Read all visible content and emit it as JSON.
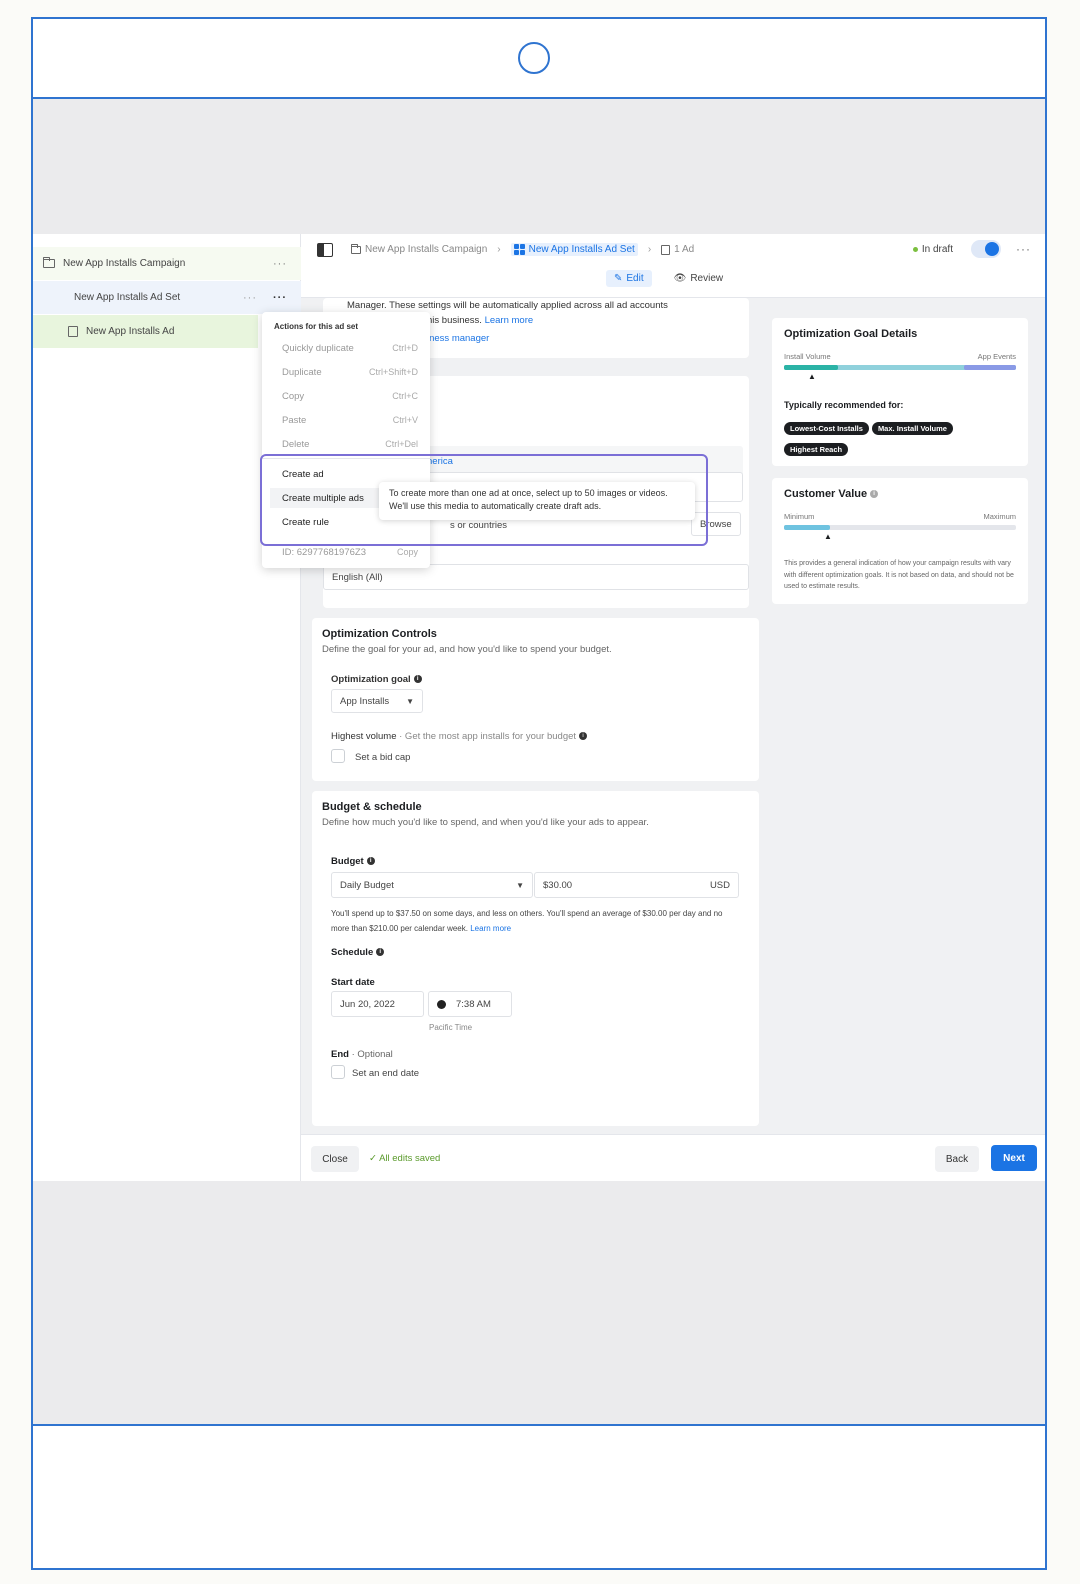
{
  "tree": {
    "campaign": "New App Installs Campaign",
    "adset": "New App Installs Ad Set",
    "ad": "New App Installs Ad",
    "more": "···"
  },
  "topbar": {
    "crumb_campaign": "New App Installs Campaign",
    "crumb_adset": "New App Installs Ad Set",
    "crumb_ad": "1 Ad",
    "status": "In draft",
    "more": "···",
    "tab_edit": "Edit",
    "tab_review": "Review"
  },
  "card_a": {
    "line1": "Manager. These settings will be automatically applied across all ad accounts",
    "line2": "his business.",
    "learn_more": "Learn more",
    "link2": "iness manager"
  },
  "card_b": {
    "location_link": "nerica",
    "countries_text": "s or countries",
    "browse": "Browse",
    "language_value": "English (All)"
  },
  "menu": {
    "title": "Actions for this ad set",
    "items": [
      {
        "label": "Quickly duplicate",
        "shortcut": "Ctrl+D"
      },
      {
        "label": "Duplicate",
        "shortcut": "Ctrl+Shift+D"
      },
      {
        "label": "Copy",
        "shortcut": "Ctrl+C"
      },
      {
        "label": "Paste",
        "shortcut": "Ctrl+V"
      },
      {
        "label": "Delete",
        "shortcut": "Ctrl+Del"
      }
    ],
    "create_ad": "Create ad",
    "create_multiple": "Create multiple ads",
    "create_rule": "Create rule",
    "id": "ID: 62977681976Z3",
    "copy": "Copy",
    "tooltip": "To create more than one ad at once, select up to 50 images or videos. We'll use this media to automatically create draft ads."
  },
  "optimization": {
    "title": "Optimization Controls",
    "subtitle": "Define the goal for your ad, and how you'd like to spend your budget.",
    "goal_label": "Optimization goal",
    "goal_value": "App Installs",
    "strategy_bold": "Highest volume",
    "strategy_rest": " · Get the most app installs for your budget",
    "bid_cap": "Set a bid cap"
  },
  "budget": {
    "title": "Budget & schedule",
    "subtitle": "Define how much you'd like to spend, and when you'd like your ads to appear.",
    "budget_label": "Budget",
    "type": "Daily Budget",
    "amount": "$30.00",
    "currency": "USD",
    "note": "You'll spend up to $37.50 on some days, and less on others. You'll spend an average of $30.00 per day and no more than $210.00 per calendar week.",
    "learn_more": "Learn more",
    "schedule_label": "Schedule",
    "start_label": "Start date",
    "start_date": "Jun 20, 2022",
    "start_time": "7:38 AM",
    "timezone": "Pacific Time",
    "end_label": "End",
    "end_optional": " · Optional",
    "end_checkbox": "Set an end date"
  },
  "goal_details": {
    "title": "Optimization Goal Details",
    "left": "Install Volume",
    "right": "App Events",
    "recommended": "Typically recommended for:",
    "pills": [
      "Lowest-Cost Installs",
      "Max. Install Volume",
      "Highest Reach"
    ]
  },
  "customer_value": {
    "title": "Customer Value",
    "min": "Minimum",
    "max": "Maximum",
    "note": "This provides a general indication of how your campaign results with vary with different optimization goals. It is not based on data, and should not be used to estimate results."
  },
  "bottom": {
    "close": "Close",
    "saved": "All edits saved",
    "back": "Back",
    "next": "Next"
  },
  "colors": {
    "accent": "#1b74e4",
    "frame": "#2f74d0",
    "highlight": "#7b6fd6"
  }
}
